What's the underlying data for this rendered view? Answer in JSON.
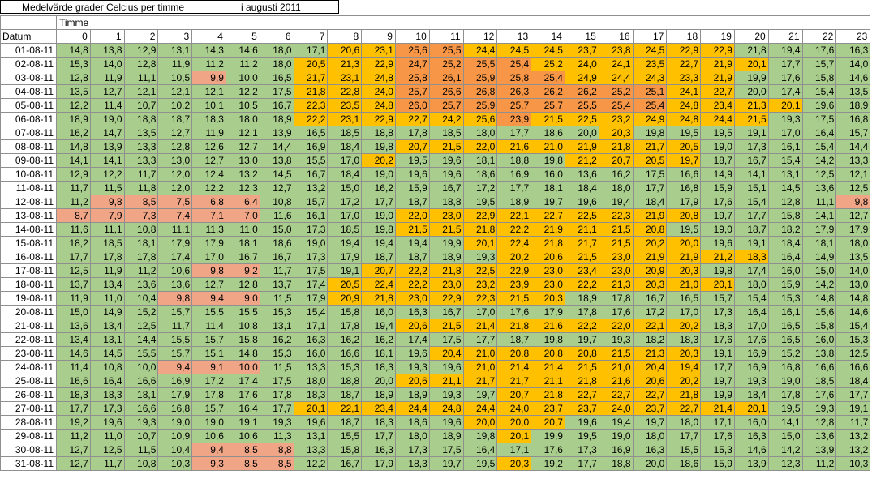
{
  "title": {
    "left": "Medelvärde grader Celcius per timme",
    "right": "i augusti 2011"
  },
  "table": {
    "header_group": "Timme",
    "header_first": "Datum",
    "hours": [
      "0",
      "1",
      "2",
      "3",
      "4",
      "5",
      "6",
      "7",
      "8",
      "9",
      "10",
      "11",
      "12",
      "13",
      "14",
      "15",
      "16",
      "17",
      "18",
      "19",
      "20",
      "21",
      "22",
      "23"
    ],
    "colors": {
      "green": "#a9cd8c",
      "yellow": "#ffc000",
      "orange": "#f79646",
      "salmon": "#f0a587"
    },
    "rows": [
      {
        "date": "01-08-11",
        "values": [
          "14,8",
          "13,8",
          "12,9",
          "13,1",
          "14,3",
          "14,6",
          "18,0",
          "17,1",
          "20,6",
          "23,1",
          "25,6",
          "25,5",
          "24,4",
          "24,5",
          "24,5",
          "23,7",
          "23,8",
          "24,5",
          "22,9",
          "22,9",
          "21,8",
          "19,4",
          "17,6",
          "16,3"
        ],
        "colors": "0000000011221111111100000"
      },
      {
        "date": "02-08-11",
        "values": [
          "15,3",
          "14,0",
          "12,8",
          "11,9",
          "11,2",
          "11,2",
          "18,0",
          "20,5",
          "21,3",
          "22,9",
          "24,7",
          "25,2",
          "25,5",
          "25,4",
          "25,2",
          "24,0",
          "24,1",
          "23,5",
          "22,7",
          "21,9",
          "20,1",
          "17,7",
          "15,7",
          "14,0"
        ],
        "colors": "000000011122221111111000"
      },
      {
        "date": "03-08-11",
        "values": [
          "12,8",
          "11,9",
          "11,1",
          "10,5",
          "9,9",
          "10,0",
          "16,5",
          "21,7",
          "23,1",
          "24,8",
          "25,8",
          "26,1",
          "25,9",
          "25,8",
          "25,4",
          "24,9",
          "24,4",
          "24,3",
          "23,3",
          "21,9",
          "19,9",
          "17,6",
          "15,8",
          "14,6"
        ],
        "colors": "000030011122222111110000"
      },
      {
        "date": "04-08-11",
        "values": [
          "13,5",
          "12,7",
          "12,1",
          "12,1",
          "12,1",
          "12,2",
          "17,5",
          "21,8",
          "22,8",
          "24,0",
          "25,7",
          "26,6",
          "26,8",
          "26,3",
          "26,2",
          "26,2",
          "25,2",
          "25,1",
          "24,1",
          "22,7",
          "20,0",
          "17,4",
          "15,4",
          "13,5"
        ],
        "colors": "000000011122222222110000"
      },
      {
        "date": "05-08-11",
        "values": [
          "12,2",
          "11,4",
          "10,7",
          "10,2",
          "10,1",
          "10,5",
          "16,7",
          "22,3",
          "23,5",
          "24,8",
          "26,0",
          "25,7",
          "25,9",
          "25,7",
          "25,7",
          "25,5",
          "25,4",
          "25,4",
          "24,8",
          "23,4",
          "21,3",
          "20,1",
          "19,6",
          "18,9"
        ],
        "colors": "000000011122222222111100"
      },
      {
        "date": "06-08-11",
        "values": [
          "18,9",
          "19,0",
          "18,8",
          "18,7",
          "18,3",
          "18,0",
          "18,9",
          "22,2",
          "23,1",
          "22,9",
          "22,7",
          "24,2",
          "25,6",
          "23,9",
          "21,5",
          "22,5",
          "23,2",
          "24,9",
          "24,8",
          "24,4",
          "21,5",
          "19,3",
          "17,5",
          "16,8"
        ],
        "colors": "000000011111121111111000"
      },
      {
        "date": "07-08-11",
        "values": [
          "16,2",
          "14,7",
          "13,5",
          "12,7",
          "11,9",
          "12,1",
          "13,9",
          "16,5",
          "18,5",
          "18,8",
          "17,8",
          "18,5",
          "18,0",
          "17,7",
          "18,6",
          "20,0",
          "20,3",
          "19,8",
          "19,5",
          "19,5",
          "19,1",
          "17,0",
          "16,4",
          "15,7"
        ],
        "colors": "000000000000000010000000"
      },
      {
        "date": "08-08-11",
        "values": [
          "14,8",
          "13,9",
          "13,3",
          "12,8",
          "12,6",
          "12,7",
          "14,4",
          "16,9",
          "18,4",
          "19,8",
          "20,7",
          "21,5",
          "22,0",
          "21,6",
          "21,0",
          "21,9",
          "21,8",
          "21,7",
          "20,5",
          "19,0",
          "17,3",
          "16,1",
          "15,4",
          "14,4"
        ],
        "colors": "000000000011111111100000"
      },
      {
        "date": "09-08-11",
        "values": [
          "14,1",
          "14,1",
          "13,3",
          "13,0",
          "12,7",
          "13,0",
          "13,8",
          "15,5",
          "17,0",
          "20,2",
          "19,5",
          "19,6",
          "18,1",
          "18,8",
          "19,8",
          "21,2",
          "20,7",
          "20,5",
          "19,7",
          "18,7",
          "16,7",
          "15,4",
          "14,2",
          "13,3"
        ],
        "colors": "000000000100000111100000"
      },
      {
        "date": "10-08-11",
        "values": [
          "12,9",
          "12,2",
          "11,7",
          "12,0",
          "12,4",
          "13,2",
          "14,5",
          "16,7",
          "18,4",
          "19,0",
          "19,6",
          "19,6",
          "18,6",
          "16,9",
          "16,0",
          "13,6",
          "16,2",
          "17,5",
          "16,6",
          "14,9",
          "14,1",
          "13,1",
          "12,5",
          "12,1"
        ],
        "colors": "000000000000000000000000"
      },
      {
        "date": "11-08-11",
        "values": [
          "11,7",
          "11,5",
          "11,8",
          "12,0",
          "12,2",
          "12,3",
          "12,7",
          "13,2",
          "15,0",
          "16,2",
          "15,9",
          "16,7",
          "17,2",
          "17,7",
          "18,1",
          "18,4",
          "18,0",
          "17,7",
          "16,8",
          "15,9",
          "15,1",
          "14,5",
          "13,6",
          "12,5"
        ],
        "colors": "000000000000000000000000"
      },
      {
        "date": "12-08-11",
        "values": [
          "11,2",
          "9,8",
          "8,5",
          "7,5",
          "6,8",
          "6,4",
          "10,8",
          "15,7",
          "17,2",
          "17,7",
          "18,7",
          "18,8",
          "19,5",
          "18,9",
          "19,7",
          "19,6",
          "19,4",
          "18,4",
          "17,9",
          "17,6",
          "15,4",
          "12,8",
          "11,1",
          "9,8"
        ],
        "colors": "033333000000000000000003"
      },
      {
        "date": "13-08-11",
        "values": [
          "8,7",
          "7,9",
          "7,3",
          "7,4",
          "7,1",
          "7,0",
          "11,6",
          "16,1",
          "17,0",
          "19,0",
          "22,0",
          "23,0",
          "22,9",
          "22,1",
          "22,7",
          "22,5",
          "22,3",
          "21,9",
          "20,8",
          "19,7",
          "17,7",
          "15,8",
          "14,1",
          "12,7"
        ],
        "colors": "333333000011111111100000"
      },
      {
        "date": "14-08-11",
        "values": [
          "11,6",
          "11,1",
          "10,8",
          "11,1",
          "11,3",
          "11,0",
          "15,0",
          "17,3",
          "18,5",
          "19,8",
          "21,5",
          "21,5",
          "21,8",
          "22,2",
          "21,9",
          "21,1",
          "21,5",
          "20,8",
          "19,5",
          "19,0",
          "18,7",
          "18,2",
          "17,9",
          "17,9"
        ],
        "colors": "000000000011111111000000"
      },
      {
        "date": "15-08-11",
        "values": [
          "18,2",
          "18,5",
          "18,1",
          "17,9",
          "17,9",
          "18,1",
          "18,6",
          "19,0",
          "19,4",
          "19,4",
          "19,4",
          "19,9",
          "20,1",
          "22,4",
          "21,8",
          "21,7",
          "21,5",
          "20,2",
          "20,0",
          "19,6",
          "19,1",
          "18,4",
          "18,1",
          "18,0"
        ],
        "colors": "000000000000111111100000"
      },
      {
        "date": "16-08-11",
        "values": [
          "17,7",
          "17,8",
          "17,8",
          "17,4",
          "17,0",
          "16,7",
          "16,7",
          "17,3",
          "17,9",
          "18,7",
          "18,7",
          "18,9",
          "19,3",
          "20,2",
          "20,6",
          "21,5",
          "23,0",
          "21,9",
          "21,9",
          "21,2",
          "18,3",
          "16,4",
          "14,9",
          "13,5"
        ],
        "colors": "000000000000011111111000"
      },
      {
        "date": "17-08-11",
        "values": [
          "12,5",
          "11,9",
          "11,2",
          "10,6",
          "9,8",
          "9,2",
          "11,7",
          "17,5",
          "19,1",
          "20,7",
          "22,2",
          "21,8",
          "22,5",
          "22,9",
          "23,0",
          "23,4",
          "23,0",
          "20,9",
          "20,3",
          "19,8",
          "17,4",
          "16,0",
          "15,0",
          "14,0"
        ],
        "colors": "000033000111111111100000"
      },
      {
        "date": "18-08-11",
        "values": [
          "13,7",
          "13,4",
          "13,6",
          "13,6",
          "12,7",
          "12,8",
          "13,7",
          "17,4",
          "20,5",
          "22,4",
          "22,2",
          "23,0",
          "23,2",
          "23,9",
          "23,0",
          "22,2",
          "21,3",
          "20,3",
          "21,0",
          "20,1",
          "18,0",
          "15,9",
          "14,2",
          "13,0"
        ],
        "colors": "000000001111111111110000"
      },
      {
        "date": "19-08-11",
        "values": [
          "11,9",
          "11,0",
          "10,4",
          "9,8",
          "9,4",
          "9,0",
          "11,5",
          "17,9",
          "20,9",
          "21,8",
          "23,0",
          "22,9",
          "22,3",
          "21,5",
          "20,3",
          "18,9",
          "17,8",
          "16,7",
          "16,5",
          "15,7",
          "15,4",
          "15,3",
          "14,8",
          "14,8"
        ],
        "colors": "000333001111111000000000"
      },
      {
        "date": "20-08-11",
        "values": [
          "15,0",
          "14,9",
          "15,2",
          "15,7",
          "15,5",
          "15,5",
          "15,3",
          "15,4",
          "15,8",
          "16,0",
          "16,3",
          "16,7",
          "17,0",
          "17,6",
          "17,9",
          "17,8",
          "17,6",
          "17,2",
          "17,0",
          "17,3",
          "16,4",
          "16,1",
          "15,6",
          "14,6"
        ],
        "colors": "000000000000000000000000"
      },
      {
        "date": "21-08-11",
        "values": [
          "13,6",
          "13,4",
          "12,5",
          "11,7",
          "11,4",
          "10,8",
          "13,1",
          "17,1",
          "17,8",
          "19,4",
          "20,6",
          "21,5",
          "21,4",
          "21,8",
          "21,6",
          "22,2",
          "22,0",
          "22,1",
          "20,2",
          "18,3",
          "17,0",
          "16,5",
          "15,8",
          "15,4"
        ],
        "colors": "000000000011111111100000"
      },
      {
        "date": "22-08-11",
        "values": [
          "13,4",
          "13,1",
          "14,4",
          "15,5",
          "15,7",
          "15,8",
          "16,2",
          "16,3",
          "16,2",
          "16,2",
          "17,4",
          "17,5",
          "17,7",
          "18,7",
          "19,8",
          "19,7",
          "19,3",
          "18,2",
          "18,3",
          "17,6",
          "17,6",
          "16,5",
          "16,0",
          "15,3"
        ],
        "colors": "000000000000000000000000"
      },
      {
        "date": "23-08-11",
        "values": [
          "14,6",
          "14,5",
          "15,5",
          "15,7",
          "15,1",
          "14,8",
          "15,3",
          "16,0",
          "16,6",
          "18,1",
          "19,6",
          "20,4",
          "21,0",
          "20,8",
          "20,8",
          "20,8",
          "21,5",
          "21,3",
          "20,3",
          "19,1",
          "16,9",
          "15,2",
          "13,8",
          "12,5"
        ],
        "colors": "000000000001111111100000"
      },
      {
        "date": "24-08-11",
        "values": [
          "11,4",
          "10,8",
          "10,0",
          "9,4",
          "9,1",
          "10,0",
          "11,5",
          "13,3",
          "15,3",
          "18,3",
          "19,3",
          "19,6",
          "21,0",
          "21,4",
          "21,4",
          "21,5",
          "21,0",
          "20,4",
          "19,4",
          "17,7",
          "16,9",
          "16,8",
          "16,6",
          "16,6"
        ],
        "colors": "000333000000111111100000"
      },
      {
        "date": "25-08-11",
        "values": [
          "16,6",
          "16,4",
          "16,6",
          "16,9",
          "17,2",
          "17,4",
          "17,5",
          "18,0",
          "18,8",
          "20,0",
          "20,6",
          "21,1",
          "21,7",
          "21,7",
          "21,1",
          "21,8",
          "21,6",
          "20,6",
          "20,2",
          "19,7",
          "19,3",
          "19,0",
          "18,5",
          "18,4"
        ],
        "colors": "000000000011111111100000"
      },
      {
        "date": "26-08-11",
        "values": [
          "18,3",
          "18,3",
          "18,1",
          "17,9",
          "17,8",
          "17,6",
          "17,8",
          "18,3",
          "18,7",
          "18,9",
          "18,9",
          "19,3",
          "19,7",
          "20,7",
          "21,8",
          "22,7",
          "22,7",
          "22,7",
          "21,8",
          "19,9",
          "18,4",
          "17,8",
          "17,6",
          "17,7"
        ],
        "colors": "000000000000011111100000"
      },
      {
        "date": "27-08-11",
        "values": [
          "17,7",
          "17,3",
          "16,6",
          "16,8",
          "15,7",
          "16,4",
          "17,7",
          "20,1",
          "22,1",
          "23,4",
          "24,4",
          "24,8",
          "24,4",
          "24,0",
          "23,7",
          "23,7",
          "24,0",
          "23,7",
          "22,7",
          "21,4",
          "20,1",
          "19,5",
          "19,3",
          "19,1"
        ],
        "colors": "000000011111111111111000"
      },
      {
        "date": "28-08-11",
        "values": [
          "19,2",
          "19,6",
          "19,3",
          "19,0",
          "19,0",
          "19,1",
          "19,3",
          "19,6",
          "18,7",
          "18,3",
          "18,6",
          "19,6",
          "20,0",
          "20,0",
          "20,7",
          "19,6",
          "19,4",
          "19,7",
          "18,0",
          "17,1",
          "16,0",
          "14,1",
          "12,8",
          "11,7"
        ],
        "colors": "000000000000111000000000"
      },
      {
        "date": "29-08-11",
        "values": [
          "11,2",
          "11,0",
          "10,7",
          "10,9",
          "10,6",
          "10,6",
          "11,3",
          "13,1",
          "15,5",
          "17,7",
          "18,0",
          "18,9",
          "19,8",
          "20,1",
          "19,9",
          "19,5",
          "19,0",
          "18,0",
          "17,7",
          "17,6",
          "16,3",
          "15,0",
          "13,6",
          "13,2"
        ],
        "colors": "000000000000010000000000"
      },
      {
        "date": "30-08-11",
        "values": [
          "12,7",
          "12,5",
          "11,5",
          "10,4",
          "9,4",
          "8,5",
          "8,8",
          "13,3",
          "15,8",
          "16,3",
          "17,3",
          "17,5",
          "16,4",
          "17,1",
          "17,6",
          "17,3",
          "16,9",
          "16,3",
          "15,5",
          "15,3",
          "14,6",
          "14,2",
          "13,9",
          "13,2"
        ],
        "colors": "000033300000000000000000"
      },
      {
        "date": "31-08-11",
        "values": [
          "12,7",
          "11,7",
          "10,8",
          "10,3",
          "9,3",
          "8,5",
          "8,5",
          "12,2",
          "16,7",
          "17,9",
          "18,3",
          "19,7",
          "19,5",
          "20,3",
          "19,2",
          "17,7",
          "18,8",
          "20,0",
          "18,6",
          "15,9",
          "13,9",
          "12,3",
          "11,2",
          "10,3"
        ],
        "colors": "000033300000010000000000"
      }
    ]
  }
}
